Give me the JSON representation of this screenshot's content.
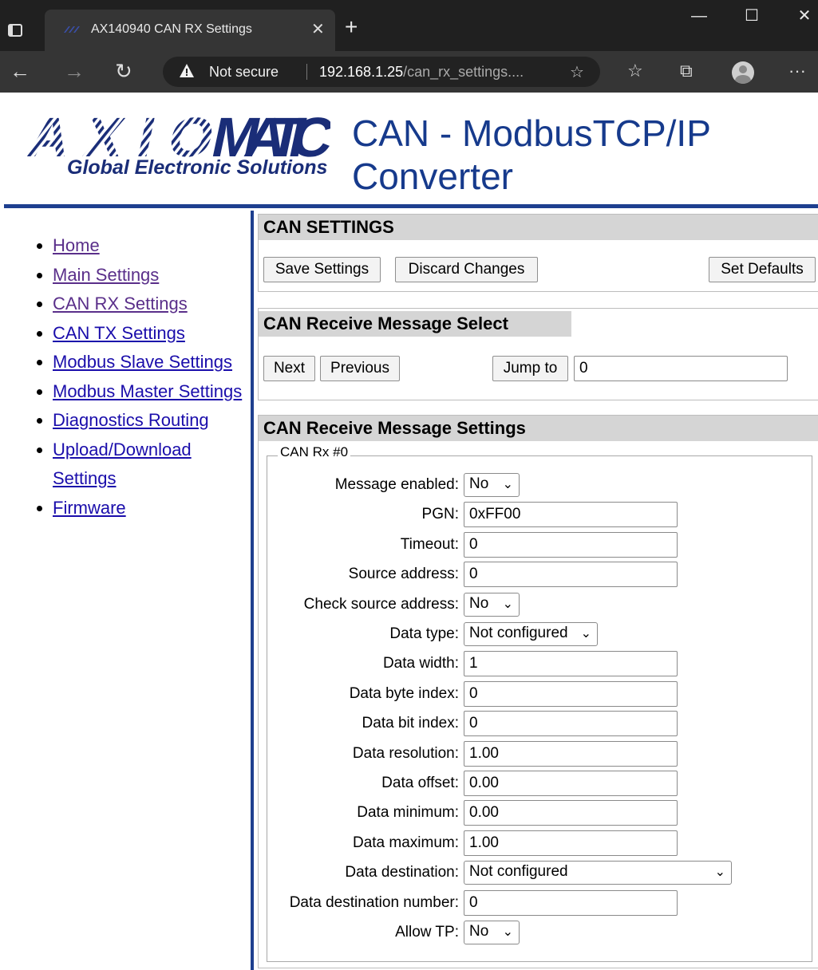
{
  "browser": {
    "tab_title": "AX140940 CAN RX Settings",
    "tab_close": "✕",
    "new_tab": "+",
    "security_label": "Not secure",
    "url_host": "192.168.1.25",
    "url_path": "/can_rx_settings....",
    "window_controls": [
      "—",
      "☐",
      "✕"
    ],
    "more": "···"
  },
  "header": {
    "logo_text": "AXIOMATIC",
    "logo_tagline": "Global Electronic Solutions",
    "title": "CAN - ModbusTCP/IP Converter"
  },
  "nav": {
    "items": [
      {
        "label": "Home",
        "visited": true
      },
      {
        "label": "Main Settings",
        "visited": true
      },
      {
        "label": "CAN RX Settings",
        "visited": true
      },
      {
        "label": "CAN TX Settings",
        "visited": false
      },
      {
        "label": "Modbus Slave Settings",
        "visited": false
      },
      {
        "label": "Modbus Master Settings",
        "visited": false
      },
      {
        "label": "Diagnostics Routing",
        "visited": false
      },
      {
        "label": "Upload/Download Settings",
        "visited": false
      },
      {
        "label": "Firmware",
        "visited": false
      }
    ]
  },
  "can_settings": {
    "title": "CAN SETTINGS",
    "save": "Save Settings",
    "discard": "Discard Changes",
    "defaults": "Set Defaults"
  },
  "message_select": {
    "title": "CAN Receive Message Select",
    "next": "Next",
    "previous": "Previous",
    "jump": "Jump to",
    "jump_value": "0"
  },
  "message_settings": {
    "title": "CAN Receive Message Settings",
    "legend": "CAN Rx #0",
    "rows": [
      {
        "label": "Message enabled:",
        "type": "select",
        "value": "No"
      },
      {
        "label": "PGN:",
        "type": "input",
        "value": "0xFF00"
      },
      {
        "label": "Timeout:",
        "type": "input",
        "value": "0"
      },
      {
        "label": "Source address:",
        "type": "input",
        "value": "0"
      },
      {
        "label": "Check source address:",
        "type": "select",
        "value": "No"
      },
      {
        "label": "Data type:",
        "type": "select",
        "value": "Not configured"
      },
      {
        "label": "Data width:",
        "type": "input",
        "value": "1"
      },
      {
        "label": "Data byte index:",
        "type": "input",
        "value": "0"
      },
      {
        "label": "Data bit index:",
        "type": "input",
        "value": "0"
      },
      {
        "label": "Data resolution:",
        "type": "input",
        "value": "1.00"
      },
      {
        "label": "Data offset:",
        "type": "input",
        "value": "0.00"
      },
      {
        "label": "Data minimum:",
        "type": "input",
        "value": "0.00"
      },
      {
        "label": "Data maximum:",
        "type": "input",
        "value": "1.00"
      },
      {
        "label": "Data destination:",
        "type": "select",
        "value": "Not configured"
      },
      {
        "label": "Data destination number:",
        "type": "input",
        "value": "0"
      },
      {
        "label": "Allow TP:",
        "type": "select",
        "value": "No"
      }
    ]
  },
  "colors": {
    "brand_blue": "#1e3f8f",
    "section_header": "#d5d5d5",
    "link": "#1a0dab",
    "visited_link": "#5a2f8a"
  }
}
